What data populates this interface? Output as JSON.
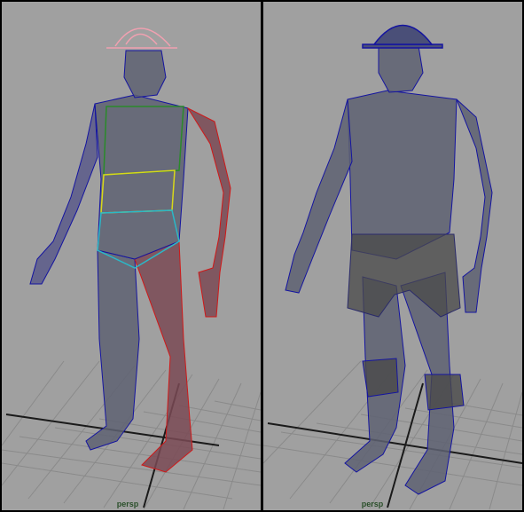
{
  "viewports": [
    {
      "camera": "persp"
    },
    {
      "camera": "persp"
    }
  ],
  "colors": {
    "background": "#a0a0a0",
    "grid": "#8a8a8a",
    "axis": "#1a1a1a",
    "mesh_fill": "#5e6272",
    "wire_blue": "#1414a0",
    "wire_red": "#d01818",
    "wire_green": "#2a8a2a",
    "wire_yellow": "#d8d81a",
    "wire_cyan": "#2ab8c8",
    "wire_pink": "#f0a0b0",
    "camera_label": "#2a4f2a"
  },
  "icons": [
    "grid-floor",
    "character-mesh"
  ]
}
